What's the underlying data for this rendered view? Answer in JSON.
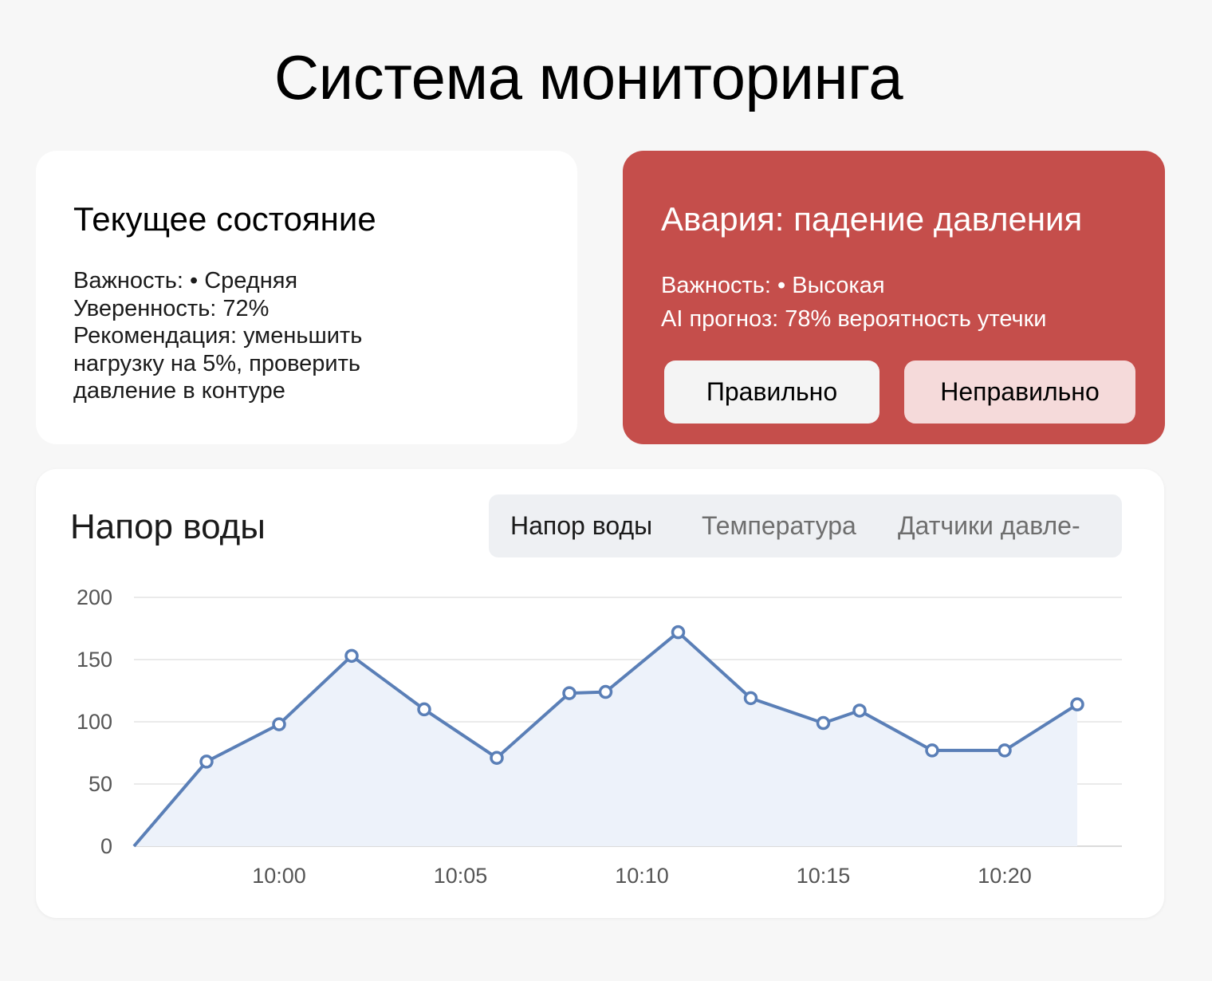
{
  "page": {
    "title": "Система мониторинга"
  },
  "status_card": {
    "title": "Текущее состояние",
    "importance": "Важность: • Средняя",
    "confidence": "Уверенность: 72%",
    "recommendation": "Рекомендация: уменьшить нагрузку на 5%, проверить давление в контуре"
  },
  "alarm_card": {
    "title": "Авария: падение давления",
    "importance": "Важность: • Высокая",
    "forecast": "AI прогноз: 78% вероятность утечки",
    "correct_label": "Правильно",
    "incorrect_label": "Неправильно",
    "color": "#c54e4b"
  },
  "chart_panel": {
    "title": "Напор воды",
    "tabs": [
      {
        "label": "Напор воды",
        "active": true
      },
      {
        "label": "Температура",
        "active": false
      },
      {
        "label": "Датчики давле-",
        "active": false
      }
    ]
  },
  "chart_data": {
    "type": "area",
    "x": [
      "09:56",
      "09:58",
      "10:00",
      "10:02",
      "10:04",
      "10:06",
      "10:08",
      "10:09",
      "10:11",
      "10:13",
      "10:15",
      "10:16",
      "10:18",
      "10:20",
      "10:22"
    ],
    "series": [
      {
        "values": [
          0,
          68,
          98,
          153,
          110,
          71,
          123,
          124,
          172,
          119,
          99,
          109,
          77,
          77,
          114
        ],
        "color": "#5a7fb7",
        "fill": "#edf2fa"
      }
    ],
    "x_ticks": [
      "10:00",
      "10:05",
      "10:10",
      "10:15",
      "10:20"
    ],
    "y_ticks": [
      "0",
      "50",
      "100",
      "150",
      "200"
    ],
    "ylim": [
      0,
      200
    ],
    "grid": true
  }
}
